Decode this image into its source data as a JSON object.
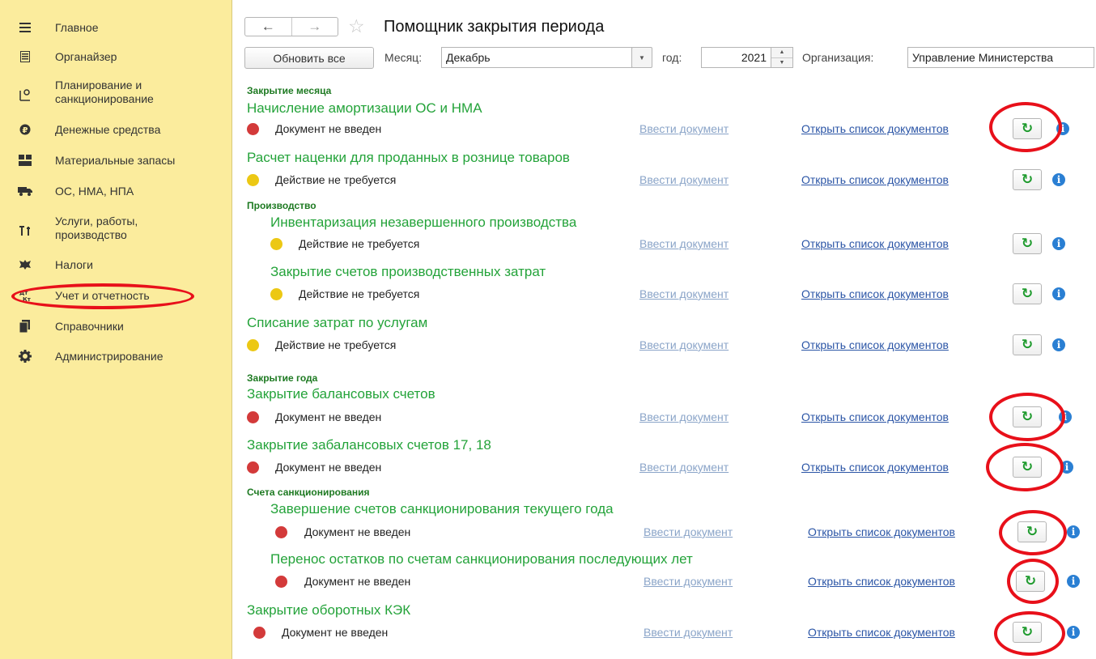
{
  "sidebar": {
    "items": [
      {
        "label": "Главное",
        "icon": "menu-icon"
      },
      {
        "label": "Органайзер",
        "icon": "organizer-icon"
      },
      {
        "label": "Планирование и\nсанкционирование",
        "icon": "planning-icon"
      },
      {
        "label": "Денежные средства",
        "icon": "money-icon"
      },
      {
        "label": "Материальные запасы",
        "icon": "inventory-icon"
      },
      {
        "label": "ОС, НМА, НПА",
        "icon": "truck-icon"
      },
      {
        "label": "Услуги, работы,\nпроизводство",
        "icon": "services-icon"
      },
      {
        "label": "Налоги",
        "icon": "taxes-icon"
      },
      {
        "label": "Учет и отчетность",
        "icon": "accounting-icon"
      },
      {
        "label": "Справочники",
        "icon": "reference-books-icon"
      },
      {
        "label": "Администрирование",
        "icon": "gear-icon"
      }
    ]
  },
  "header": {
    "title": "Помощник закрытия периода",
    "back": "←",
    "forward": "→",
    "star": "☆"
  },
  "toolbar": {
    "refresh_all": "Обновить все",
    "month_label": "Месяц:",
    "month_value": "Декабрь",
    "year_label": "год:",
    "year_value": "2021",
    "org_label": "Организация:",
    "org_value": "Управление Министерства"
  },
  "sections": {
    "month": "Закрытие месяца",
    "production": "Производство",
    "year": "Закрытие года",
    "sanction": "Счета санкционирования"
  },
  "links": {
    "enter": "Ввести документ",
    "open": "Открыть список документов",
    "refresh_icon": "↻",
    "info_icon": "i"
  },
  "tasks": [
    {
      "title": "Начисление амортизации ОС и НМА",
      "status": "Документ не введен",
      "state": "red"
    },
    {
      "title": "Расчет наценки для проданных в рознице товаров",
      "status": "Действие не требуется",
      "state": "yellow"
    },
    {
      "title": "Инвентаризация незавершенного производства",
      "status": "Действие не требуется",
      "state": "yellow"
    },
    {
      "title": "Закрытие счетов производственных затрат",
      "status": "Действие не требуется",
      "state": "yellow"
    },
    {
      "title": "Списание затрат по услугам",
      "status": "Действие не требуется",
      "state": "yellow"
    },
    {
      "title": "Закрытие балансовых счетов",
      "status": "Документ не введен",
      "state": "red"
    },
    {
      "title": "Закрытие забалансовых счетов 17, 18",
      "status": "Документ не введен",
      "state": "red"
    },
    {
      "title": "Завершение счетов санкционирования текущего года",
      "status": "Документ не введен",
      "state": "red"
    },
    {
      "title": "Перенос остатков по счетам санкционирования последующих лет",
      "status": "Документ не введен",
      "state": "red"
    },
    {
      "title": "Закрытие оборотных КЭК",
      "status": "Документ не введен",
      "state": "red"
    }
  ],
  "colors": {
    "sidebar_bg": "#fbec9d",
    "task_title": "#24a33a",
    "status_red": "#d33a3a",
    "status_yellow": "#ecc814",
    "highlight": "#e8101a"
  }
}
